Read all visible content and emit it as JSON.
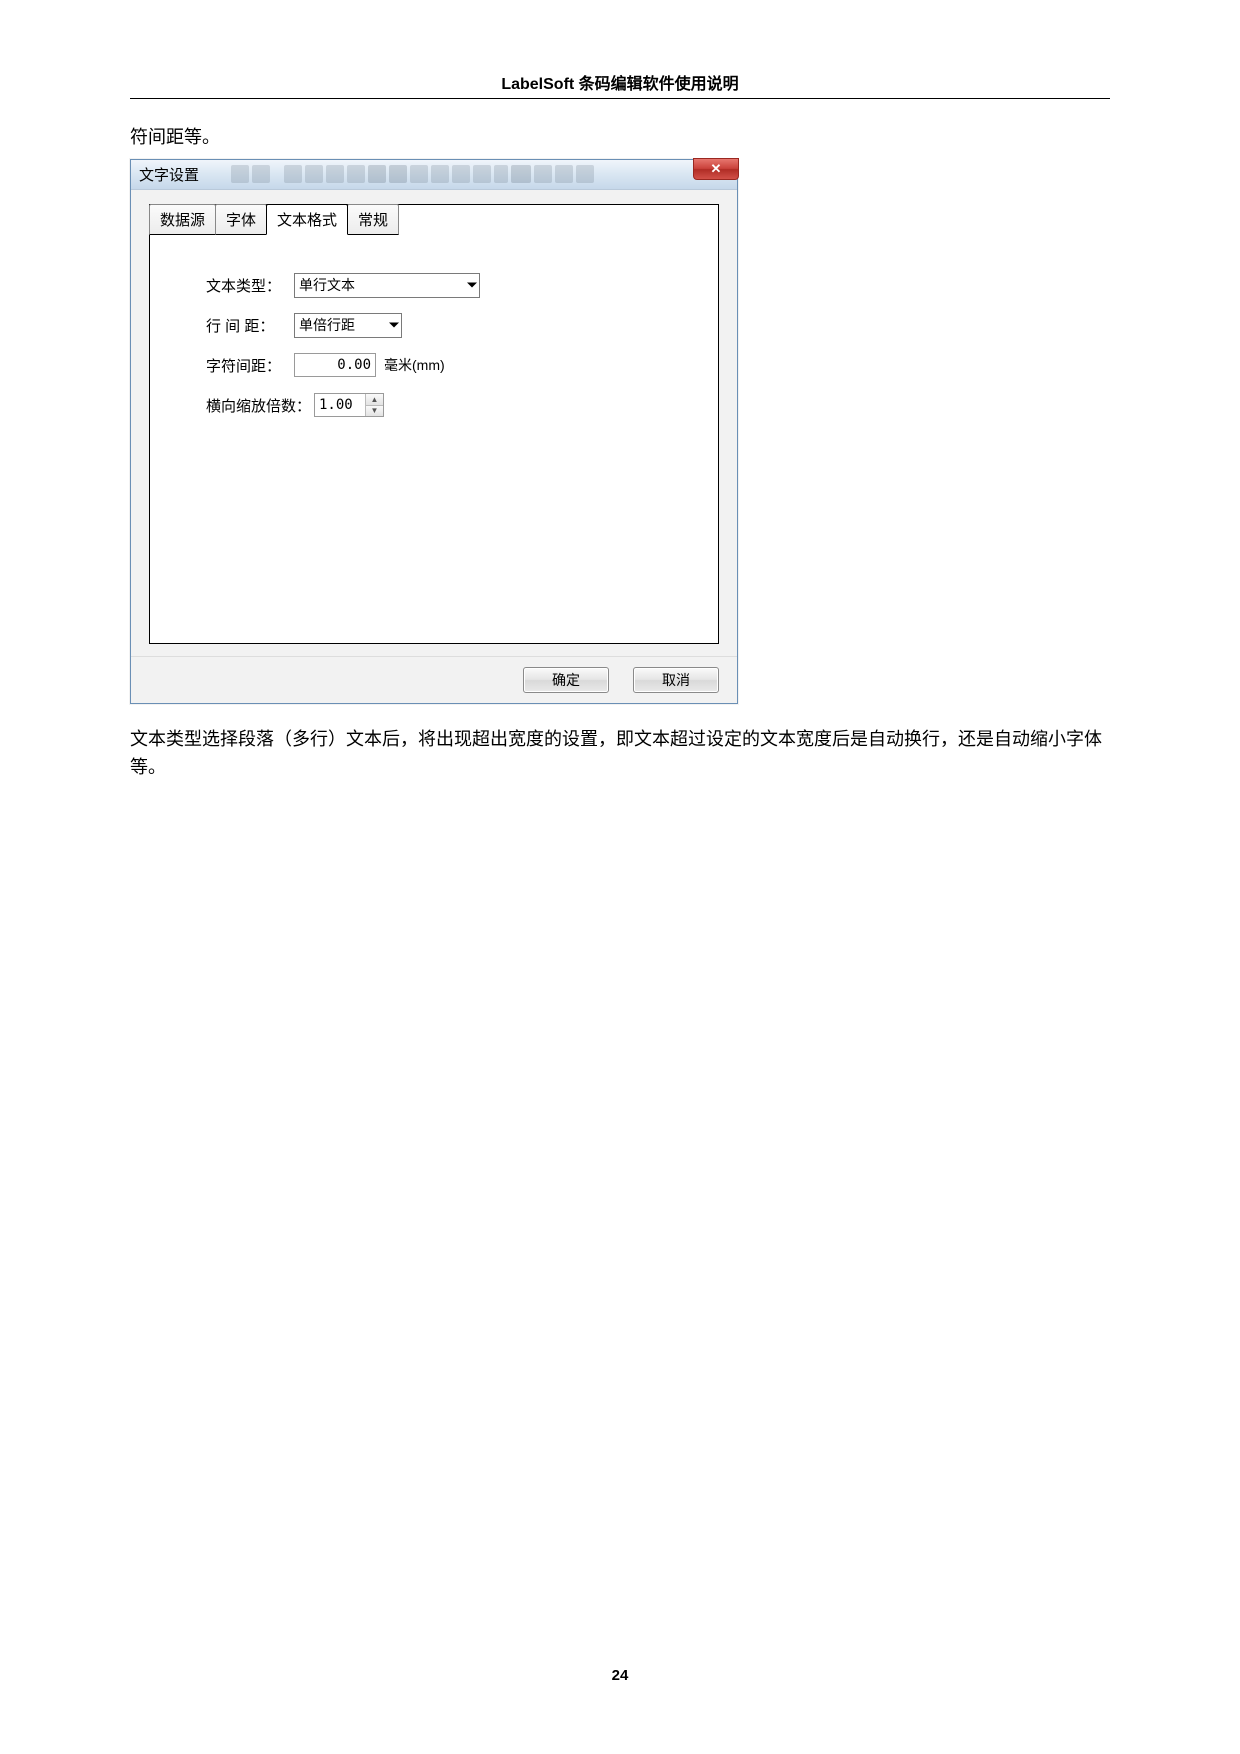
{
  "header": {
    "title": "LabelSoft 条码编辑软件使用说明"
  },
  "intro_text": "符间距等。",
  "dialog": {
    "title": "文字设置",
    "tabs": [
      {
        "label": "数据源",
        "active": false
      },
      {
        "label": "字体",
        "active": false
      },
      {
        "label": "文本格式",
        "active": true
      },
      {
        "label": "常规",
        "active": false
      }
    ],
    "form": {
      "text_type": {
        "label": "文本类型：",
        "value": "单行文本"
      },
      "line_spacing": {
        "label": "行 间 距：",
        "value": "单倍行距"
      },
      "char_spacing": {
        "label": "字符间距：",
        "value": "0.00",
        "unit": "毫米(mm)"
      },
      "horiz_scale": {
        "label": "横向缩放倍数：",
        "value": "1.00"
      }
    },
    "buttons": {
      "ok": "确定",
      "cancel": "取消"
    }
  },
  "paragraph": "文本类型选择段落（多行）文本后，将出现超出宽度的设置，即文本超过设定的文本宽度后是自动换行，还是自动缩小字体等。",
  "page_number": "24"
}
